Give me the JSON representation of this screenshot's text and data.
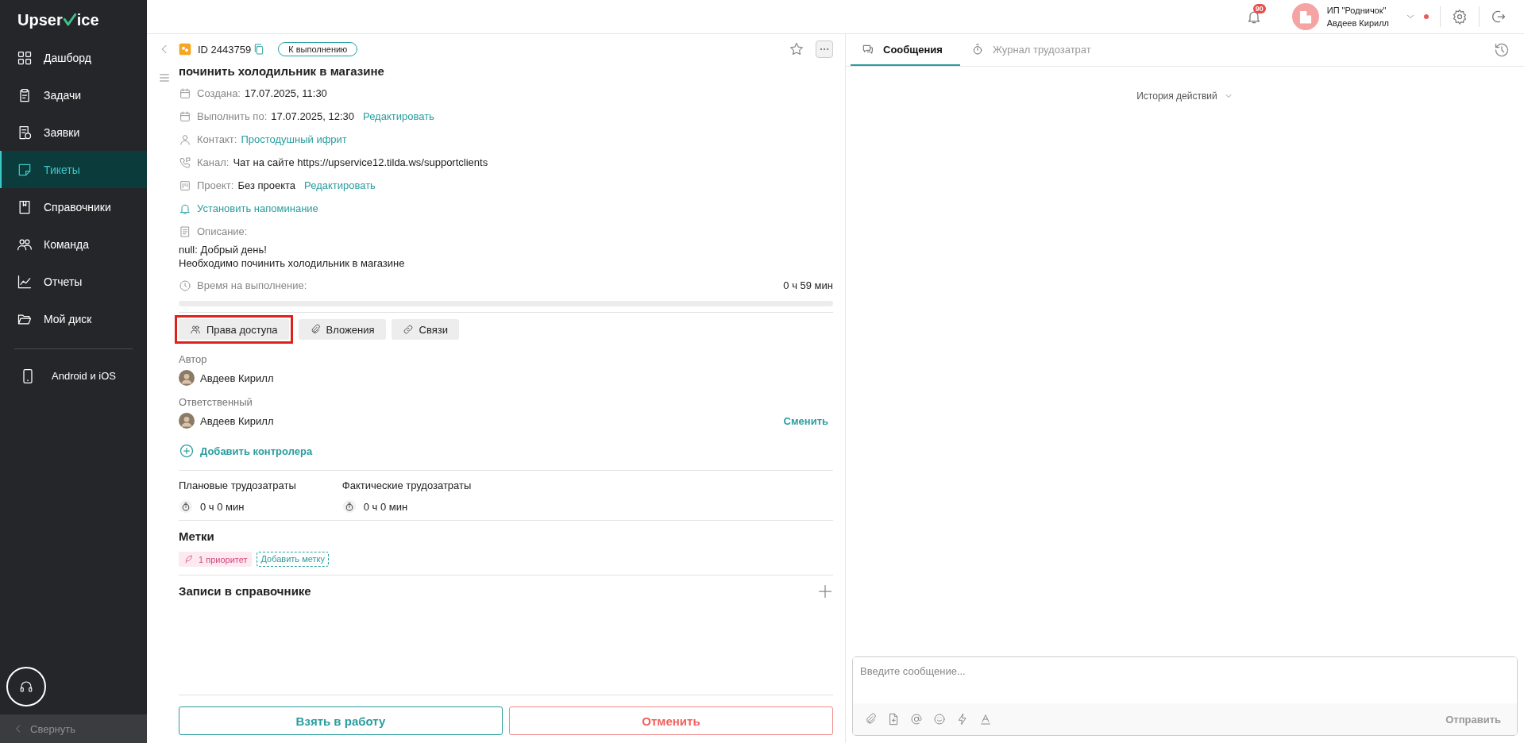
{
  "sidebar": {
    "logo": {
      "before": "Upser",
      "after": "ice"
    },
    "items": [
      {
        "label": "Дашборд",
        "selected": false
      },
      {
        "label": "Задачи",
        "selected": false
      },
      {
        "label": "Заявки",
        "selected": false
      },
      {
        "label": "Тикеты",
        "selected": true
      },
      {
        "label": "Справочники",
        "selected": false
      },
      {
        "label": "Команда",
        "selected": false
      },
      {
        "label": "Отчеты",
        "selected": false
      },
      {
        "label": "Мой диск",
        "selected": false
      }
    ],
    "apps": "Android и iOS",
    "collapse": "Свернуть"
  },
  "topbar": {
    "notifications": "90",
    "account": {
      "org": "ИП \"Родничок\"",
      "user": "Авдеев Кирилл"
    }
  },
  "ticket": {
    "id": "ID 2443759",
    "status": "К выполнению",
    "title": "починить холодильник в магазине",
    "fields": [
      {
        "label": "Создана:",
        "value": "17.07.2025, 11:30"
      },
      {
        "label": "Выполнить по:",
        "value": "17.07.2025, 12:30",
        "action": "Редактировать"
      },
      {
        "label": "Контакт:",
        "link": "Простодушный ифрит"
      },
      {
        "label": "Канал:",
        "value": "Чат на сайте https://upservice12.tilda.ws/supportclients"
      },
      {
        "label": "Проект:",
        "value": "Без проекта",
        "action": "Редактировать"
      }
    ],
    "reminder": "Установить напоминание",
    "description": {
      "label": "Описание:",
      "text": "null: Добрый день!\nНеобходимо починить холодильник в магазине"
    },
    "time": {
      "label": "Время на выполнение:",
      "value": "0 ч 59 мин",
      "level": 0
    },
    "section_tabs": [
      {
        "label": "Права доступа",
        "highlighted": true
      },
      {
        "label": "Вложения",
        "highlighted": false
      },
      {
        "label": "Связи",
        "highlighted": false
      }
    ],
    "author": {
      "label": "Автор",
      "name": "Авдеев Кирилл"
    },
    "responsible": {
      "label": "Ответственный",
      "name": "Авдеев Кирилл",
      "action": "Сменить"
    },
    "add_controller": "Добавить контролера",
    "effort": [
      {
        "label": "Плановые трудозатраты",
        "value": "0 ч 0 мин"
      },
      {
        "label": "Фактические трудозатраты",
        "value": "0 ч 0 мин"
      }
    ],
    "tags": {
      "title": "Метки",
      "items": [
        {
          "label": "1 приоритет",
          "color": "#d6457e"
        }
      ],
      "add": "Добавить метку"
    },
    "directory": {
      "title": "Записи в справочнике"
    },
    "actions": {
      "take": "Взять в работу",
      "cancel": "Отменить"
    }
  },
  "chat": {
    "tabs": [
      {
        "label": "Сообщения",
        "selected": true
      },
      {
        "label": "Журнал трудозатрат",
        "selected": false
      }
    ],
    "history": "История действий",
    "composer": {
      "placeholder": "Введите сообщение...",
      "send": "Отправить"
    }
  }
}
